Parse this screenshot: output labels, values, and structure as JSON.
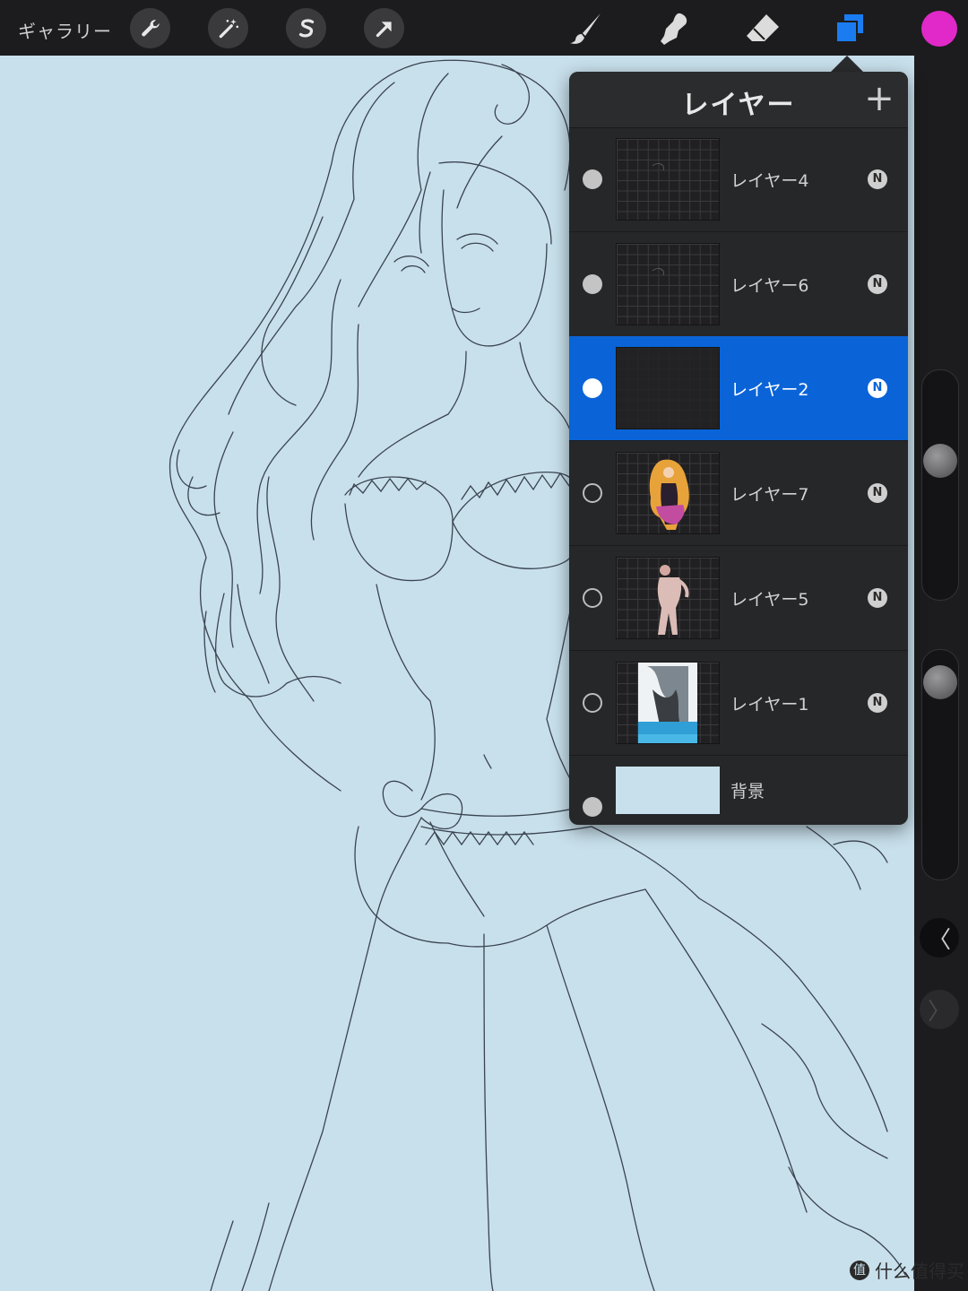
{
  "toolbar": {
    "gallery_label": "ギャラリー",
    "tools_left": [
      "wrench-icon",
      "magic-wand-icon",
      "selection-s-icon",
      "transform-arrow-icon"
    ],
    "tools_right": [
      "brush-icon",
      "smudge-icon",
      "eraser-icon",
      "layers-icon"
    ],
    "active_tool": "layers-icon",
    "current_color": "#e029c8"
  },
  "colors": {
    "canvas": "#c8e0ec",
    "panel": "#262729",
    "selected": "#0a64d8",
    "layers_icon_active": "#1a7cf0"
  },
  "layers_panel": {
    "title": "レイヤー",
    "add_label": "+",
    "layers": [
      {
        "name": "レイヤー4",
        "visible": true,
        "blend": "N",
        "selected": false,
        "thumb": "empty-sketch"
      },
      {
        "name": "レイヤー6",
        "visible": true,
        "blend": "N",
        "selected": false,
        "thumb": "empty-sketch"
      },
      {
        "name": "レイヤー2",
        "visible": true,
        "blend": "N",
        "selected": true,
        "thumb": "dark"
      },
      {
        "name": "レイヤー7",
        "visible": false,
        "blend": "N",
        "selected": false,
        "thumb": "colored-figure"
      },
      {
        "name": "レイヤー5",
        "visible": false,
        "blend": "N",
        "selected": false,
        "thumb": "skin-figure"
      },
      {
        "name": "レイヤー1",
        "visible": false,
        "blend": "N",
        "selected": false,
        "thumb": "sea-figure"
      }
    ],
    "background": {
      "name": "背景",
      "visible": true,
      "color": "#c8e0ec"
    }
  },
  "sidebar": {
    "brush_size": 0.38,
    "opacity": 0.92,
    "undo_icon": "chevron-left-icon",
    "redo_icon": "chevron-right-icon"
  },
  "watermark": {
    "text": "什么值得买",
    "icon": "值"
  }
}
